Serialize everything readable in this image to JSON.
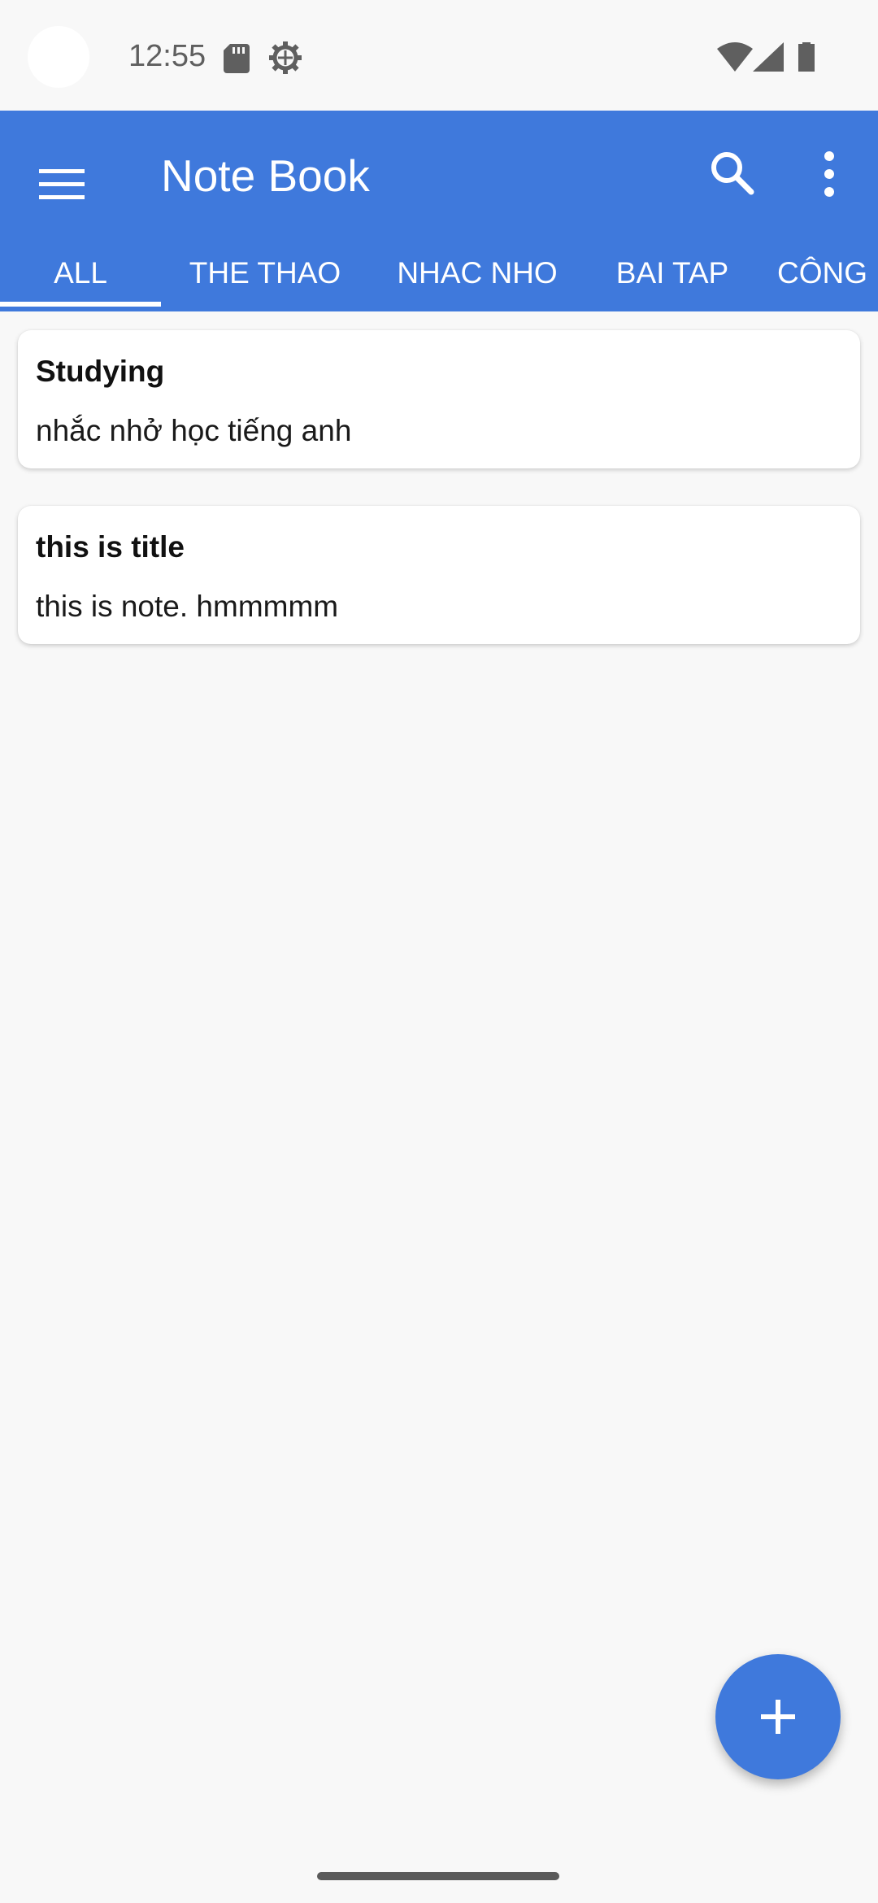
{
  "status_bar": {
    "time": "12:55",
    "icons": [
      "sd-card-icon",
      "settings-gear-icon",
      "wifi-icon",
      "cell-signal-icon",
      "battery-icon"
    ]
  },
  "app_bar": {
    "title": "Note Book",
    "menu_icon": "hamburger-menu-icon",
    "search_icon": "search-icon",
    "more_icon": "more-vert-icon"
  },
  "tabs": [
    {
      "label": "ALL",
      "active": true
    },
    {
      "label": "THE THAO",
      "active": false
    },
    {
      "label": "NHAC NHO",
      "active": false
    },
    {
      "label": "BAI TAP",
      "active": false
    },
    {
      "label": "CÔNG",
      "active": false
    }
  ],
  "notes": [
    {
      "title": "Studying",
      "body": "nhắc nhở học tiếng anh"
    },
    {
      "title": "this is title",
      "body": "this is note. hmmmmm"
    }
  ],
  "fab": {
    "icon": "plus-icon"
  },
  "colors": {
    "primary": "#3f79dc",
    "background": "#f8f8f8",
    "card": "#ffffff"
  }
}
